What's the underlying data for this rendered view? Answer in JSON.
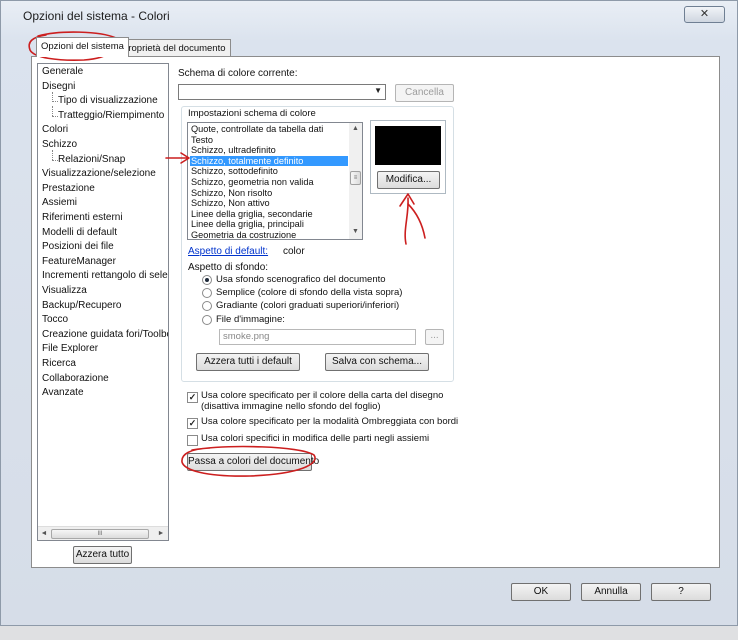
{
  "window": {
    "title": "Opzioni del sistema - Colori",
    "close": "✕"
  },
  "tabs": [
    {
      "label": "Opzioni del sistema",
      "active": true
    },
    {
      "label": "Proprietà del documento",
      "active": false
    }
  ],
  "tree": {
    "items": [
      {
        "label": "Generale",
        "child": false
      },
      {
        "label": "Disegni",
        "child": false
      },
      {
        "label": "Tipo di visualizzazione",
        "child": true
      },
      {
        "label": "Tratteggio/Riempimento",
        "child": true
      },
      {
        "label": "Colori",
        "child": false
      },
      {
        "label": "Schizzo",
        "child": false
      },
      {
        "label": "Relazioni/Snap",
        "child": true
      },
      {
        "label": "Visualizzazione/selezione",
        "child": false
      },
      {
        "label": "Prestazione",
        "child": false
      },
      {
        "label": "Assiemi",
        "child": false
      },
      {
        "label": "Riferimenti esterni",
        "child": false
      },
      {
        "label": "Modelli di default",
        "child": false
      },
      {
        "label": "Posizioni dei file",
        "child": false
      },
      {
        "label": "FeatureManager",
        "child": false
      },
      {
        "label": "Incrementi rettangolo di selez",
        "child": false
      },
      {
        "label": "Visualizza",
        "child": false
      },
      {
        "label": "Backup/Recupero",
        "child": false
      },
      {
        "label": "Tocco",
        "child": false
      },
      {
        "label": "Creazione guidata fori/Toolbo",
        "child": false
      },
      {
        "label": "File Explorer",
        "child": false
      },
      {
        "label": "Ricerca",
        "child": false
      },
      {
        "label": "Collaborazione",
        "child": false
      },
      {
        "label": "Avanzate",
        "child": false
      }
    ],
    "scroll_left": "◄",
    "scroll_right": "►",
    "scroll_grip": "III",
    "reset_all": "Azzera tutto"
  },
  "scheme": {
    "label": "Schema di colore corrente:",
    "value": "",
    "cancel": "Cancella"
  },
  "settings": {
    "group_label": "Impostazioni schema di colore",
    "items": [
      "Quote, controllate da tabella dati",
      "Testo",
      "Schizzo, ultradefinito",
      "Schizzo, totalmente definito",
      "Schizzo, sottodefinito",
      "Schizzo, geometria non valida",
      "Schizzo, Non risolto",
      "Schizzo, Non attivo",
      "Linee della griglia, secondarie",
      "Linee della griglia, principali",
      "Geometria da costruzione"
    ],
    "selected_index": 3,
    "scroll_up": "▲",
    "scroll_down": "▼",
    "scroll_grip": "≡",
    "swatch_color": "#000000",
    "modify": "Modifica...",
    "default_label": "Aspetto di default:",
    "default_value": "color"
  },
  "background": {
    "label": "Aspetto di sfondo:",
    "options": [
      {
        "label": "Usa sfondo scenografico del documento",
        "checked": true
      },
      {
        "label": "Semplice (colore di sfondo della vista sopra)",
        "checked": false
      },
      {
        "label": "Gradiante (colori graduati superiori/inferiori)",
        "checked": false
      },
      {
        "label": "File d'immagine:",
        "checked": false
      }
    ],
    "image_file": "smoke.png",
    "browse": "...",
    "reset_defaults": "Azzera tutti i default",
    "save_scheme": "Salva con schema..."
  },
  "checkboxes": [
    {
      "line1": "Usa colore specificato per il colore della carta del disegno",
      "line2": "(disattiva immagine nello sfondo del foglio)",
      "checked": true
    },
    {
      "line1": "Usa colore specificato per la modalità Ombreggiata con bordi",
      "line2": "",
      "checked": true
    },
    {
      "line1": "Usa colori specifici in modifica delle parti negli assiemi",
      "line2": "",
      "checked": false
    }
  ],
  "doc_colors_button": "Passa a colori del documento",
  "footer": {
    "ok": "OK",
    "cancel": "Annulla",
    "help": "?"
  },
  "annotation_color": "#cc1f1f"
}
